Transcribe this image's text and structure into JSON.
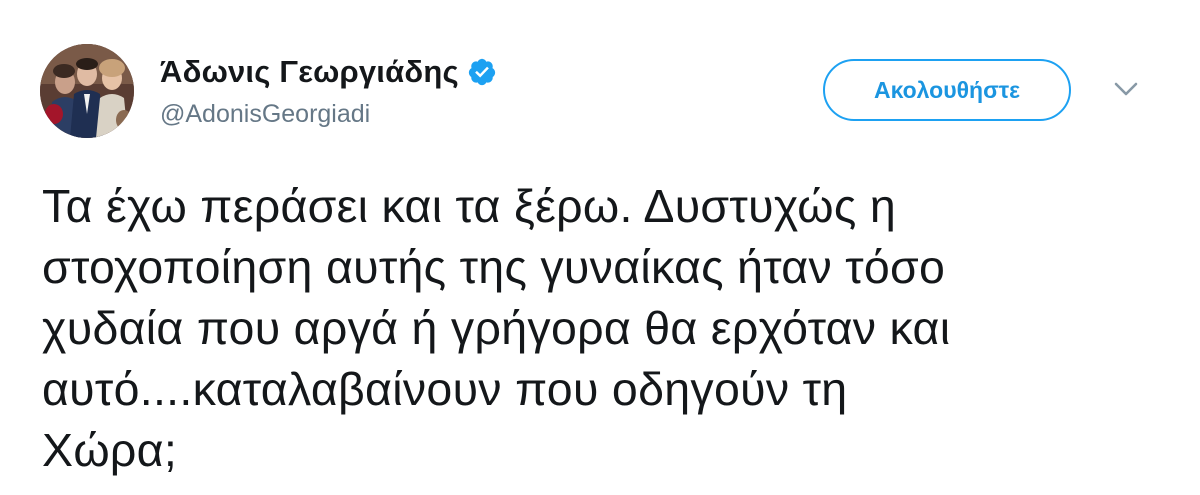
{
  "author": {
    "display_name": "Άδωνις Γεωργιάδης",
    "handle": "@AdonisGeorgiadi",
    "verified": true
  },
  "avatar_icon": "profile-photo",
  "verified_icon": "verified-badge-icon",
  "follow_button": {
    "label": "Ακολουθήστε"
  },
  "more_icon": "chevron-down-icon",
  "tweet": {
    "lines": [
      "Τα έχω περάσει και τα ξέρω. Δυστυχώς η",
      "στοχοποίηση αυτής της γυναίκας ήταν τόσο",
      "χυδαία που αργά ή γρήγορα θα ερχόταν και",
      "αυτό....καταλαβαίνουν που οδηγούν τη",
      "Χώρα;"
    ]
  },
  "colors": {
    "accent": "#1da1f2",
    "link": "#1b95e0",
    "text": "#14171a",
    "secondary_text": "#657786",
    "chevron": "#8899a6"
  }
}
